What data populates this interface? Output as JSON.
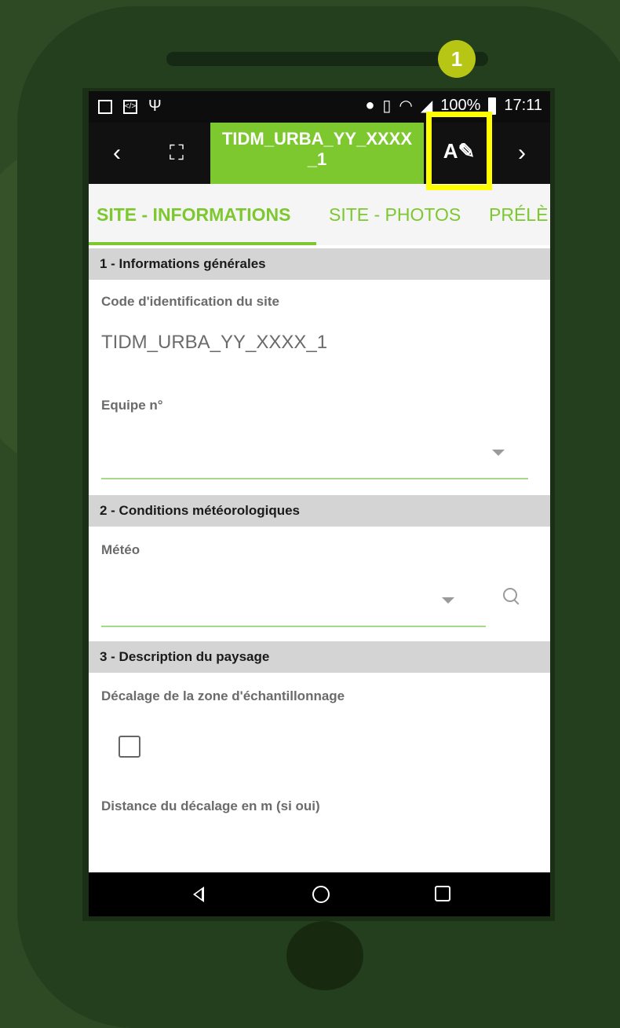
{
  "badge": "1",
  "status": {
    "battery": "100%",
    "time": "17:11"
  },
  "toolbar": {
    "back": "‹",
    "expand": "⛶",
    "title": "TIDM_URBA_YY_XXXX _1",
    "edit": "A✎",
    "next": "›"
  },
  "tabs": [
    "SITE - INFORMATIONS",
    "SITE - PHOTOS",
    "PRÉLÈ"
  ],
  "sections": [
    {
      "title": "1 - Informations générales"
    },
    {
      "title": "2 - Conditions météorologiques"
    },
    {
      "title": "3 - Description du paysage"
    }
  ],
  "fields": {
    "code_label": "Code d'identification du site",
    "code_value": "TIDM_URBA_YY_XXXX_1",
    "equipe_label": "Equipe n°",
    "meteo_label": "Météo",
    "decalage_label": "Décalage de la zone d'échantillonnage",
    "distance_label": "Distance du décalage en m (si oui)"
  }
}
